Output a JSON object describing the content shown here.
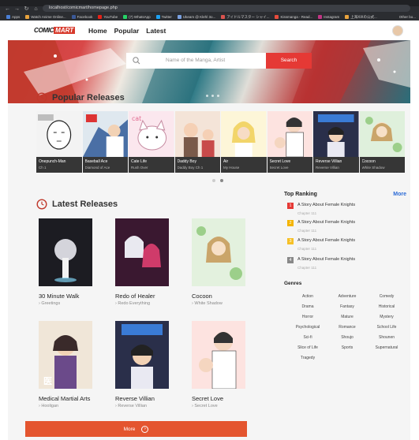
{
  "browser": {
    "url": "localhost/comicmart/homepage.php",
    "bookmarks": [
      "Apps",
      "Watch Anime Online...",
      "Facebook",
      "YouTube",
      "(7) WhatsApp",
      "Twitter",
      "Ukeam @ Klehl 3o...",
      "アイドルマスター シャイ...",
      "Kissmanga - Read...",
      "Instagram",
      "上海ⅩⅨの公式..."
    ],
    "other": "Other bo..."
  },
  "header": {
    "logo_a": "COMIC",
    "logo_b": "MART",
    "nav": [
      "Home",
      "Popular",
      "Latest"
    ]
  },
  "search": {
    "placeholder": "Name of the Manga, Artist",
    "button": "Search"
  },
  "popular": {
    "title": "Popular Releases",
    "items": [
      {
        "title": "Onepunch-Man",
        "chapter": "Ch 1"
      },
      {
        "title": "Baseball Ace",
        "chapter": "Diamond of Ace"
      },
      {
        "title": "Cate Life",
        "chapter": "Rush Over"
      },
      {
        "title": "Daddy Boy",
        "chapter": "Daddy Boy Ch 1"
      },
      {
        "title": "Air",
        "chapter": "My House"
      },
      {
        "title": "Secret Love",
        "chapter": "Secret Love"
      },
      {
        "title": "Reverse Villian",
        "chapter": "Reverse Villian"
      },
      {
        "title": "Cocoon",
        "chapter": "White Shadow"
      }
    ]
  },
  "latest": {
    "title": "Latest Releases",
    "items": [
      {
        "title": "30 Minute Walk",
        "sub": "Greetings"
      },
      {
        "title": "Redo of Healer",
        "sub": "Redo Everything"
      },
      {
        "title": "Cocoon",
        "sub": "White Shadow"
      },
      {
        "title": "Medical Martial Arts",
        "sub": "Hooligan"
      },
      {
        "title": "Reverse Villian",
        "sub": "Reverse Villian"
      },
      {
        "title": "Secret Love",
        "sub": "Secret Love"
      }
    ],
    "more": "More"
  },
  "ranking": {
    "title": "Top Ranking",
    "more": "More",
    "items": [
      {
        "num": "1",
        "title": "A Story About Female Knights",
        "chapter": "Chapter 111",
        "color": "#e53935"
      },
      {
        "num": "2",
        "title": "A Story About Female Knights",
        "chapter": "Chapter 111",
        "color": "#f4b400"
      },
      {
        "num": "3",
        "title": "A Story About Female Knights",
        "chapter": "Chapter 111",
        "color": "#f6c026"
      },
      {
        "num": "4",
        "title": "A Story About Female Knights",
        "chapter": "Chapter 111",
        "color": "#888888"
      }
    ]
  },
  "genres": {
    "title": "Genres",
    "items": [
      "Action",
      "Adventure",
      "Comedy",
      "Drama",
      "Fantasy",
      "Historical",
      "Horror",
      "Mature",
      "Mystery",
      "Psychological",
      "Romance",
      "School Life",
      "Sci-fi",
      "Shoujo",
      "Shounen",
      "Slice of Life",
      "Sports",
      "Supernatural",
      "Tragedy"
    ]
  }
}
